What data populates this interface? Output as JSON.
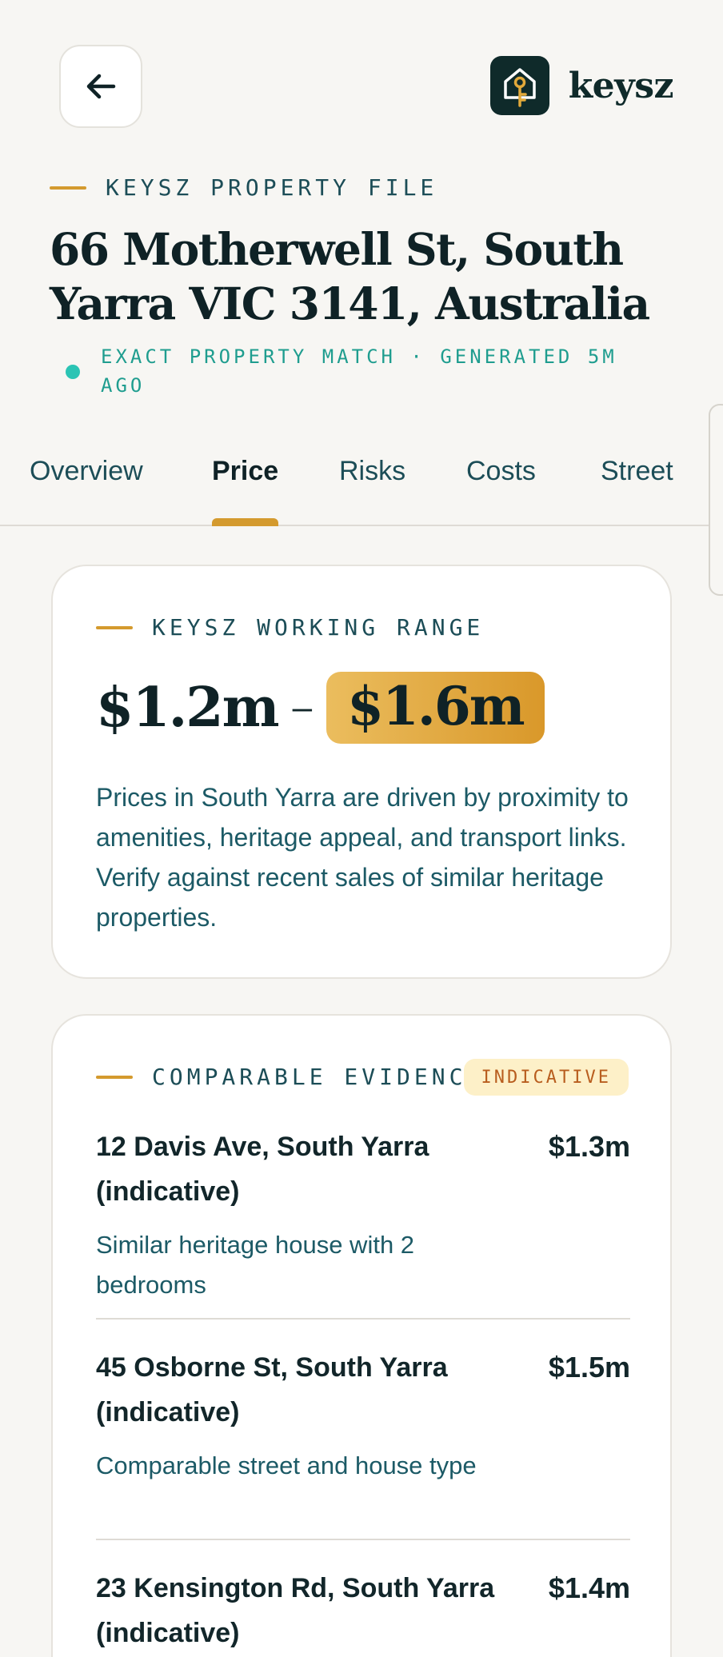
{
  "header": {
    "back_icon": "arrow-left-icon",
    "brand_icon": "house-key-icon",
    "brand_name": "keysz",
    "colors": {
      "brand_bg": "#0f2a2a",
      "accent": "#d49a2e"
    }
  },
  "property": {
    "eyebrow": "KEYSZ PROPERTY FILE",
    "address": "66 Motherwell St, South Yarra VIC 3141, Australia",
    "status": "EXACT PROPERTY MATCH · GENERATED 5M AGO",
    "status_color": "#2bc4b4"
  },
  "tabs": [
    {
      "label": "Overview",
      "active": false
    },
    {
      "label": "Price",
      "active": true
    },
    {
      "label": "Risks",
      "active": false
    },
    {
      "label": "Costs",
      "active": false
    },
    {
      "label": "Street",
      "active": false
    }
  ],
  "range": {
    "eyebrow": "KEYSZ WORKING RANGE",
    "low": "$1.2m",
    "separator": "–",
    "high": "$1.6m",
    "description": "Prices in South Yarra are driven by proximity to amenities, heritage appeal, and transport links. Verify against recent sales of similar heritage properties."
  },
  "comparables": {
    "eyebrow": "COMPARABLE EVIDENCE",
    "badge": "INDICATIVE",
    "items": [
      {
        "name": "12 Davis Ave, South Yarra (indicative)",
        "price": "$1.3m",
        "note": "Similar heritage house with 2 bedrooms"
      },
      {
        "name": "45 Osborne St, South Yarra (indicative)",
        "price": "$1.5m",
        "note": "Comparable street and house type"
      },
      {
        "name": "23 Kensington Rd, South Yarra (indicative)",
        "price": "$1.4m",
        "note": ""
      }
    ]
  }
}
